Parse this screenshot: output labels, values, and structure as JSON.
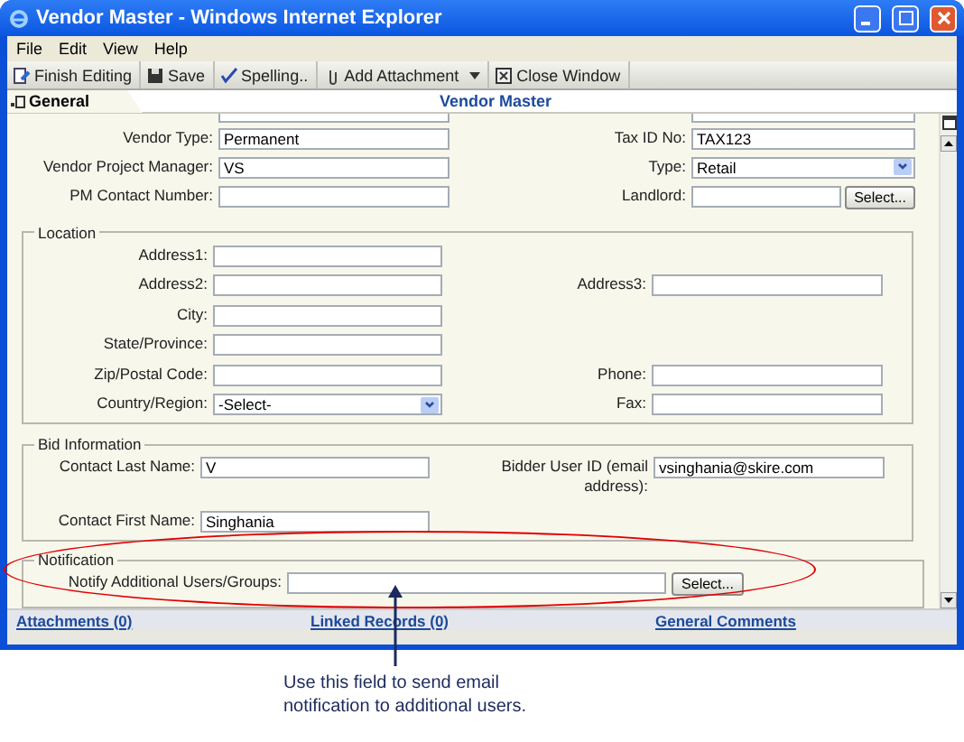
{
  "window": {
    "title": "Vendor Master - Windows Internet Explorer"
  },
  "menu": [
    "File",
    "Edit",
    "View",
    "Help"
  ],
  "toolbar": [
    {
      "label": "Finish Editing",
      "has_menu": false
    },
    {
      "label": "Save",
      "has_menu": false
    },
    {
      "label": "Spelling..",
      "has_menu": false
    },
    {
      "label": "Add Attachment",
      "has_menu": true
    },
    {
      "label": "Close Window",
      "has_menu": false
    }
  ],
  "tab": {
    "label": "General",
    "selected": true
  },
  "form_title": "Vendor Master",
  "header_rows": [
    {
      "left": {
        "label": "Vendor Type:",
        "value": "Permanent",
        "kind": "text"
      },
      "right": {
        "label": "Tax ID No:",
        "value": "TAX123",
        "kind": "text"
      }
    },
    {
      "left": {
        "label": "Vendor Project Manager:",
        "value": "VS",
        "kind": "text"
      },
      "right": {
        "label": "Type:",
        "value": "Retail",
        "kind": "select"
      }
    },
    {
      "left": {
        "label": "PM Contact Number:",
        "kind": "text"
      },
      "right": {
        "label": "Landlord:",
        "kind": "picker",
        "button": "Select..."
      }
    }
  ],
  "location": {
    "legend": "Location",
    "rows": [
      {
        "left": {
          "label": "Address1:",
          "kind": "text"
        }
      },
      {
        "left": {
          "label": "Address2:",
          "kind": "text"
        },
        "right": {
          "label": "Address3:",
          "kind": "text"
        }
      },
      {
        "left": {
          "label": "City:",
          "kind": "text"
        }
      },
      {
        "left": {
          "label": "State/Province:",
          "kind": "text"
        }
      },
      {
        "left": {
          "label": "Zip/Postal Code:",
          "kind": "text"
        },
        "right": {
          "label": "Phone:",
          "kind": "text"
        }
      },
      {
        "left": {
          "label": "Country/Region:",
          "value": "-Select-",
          "kind": "select"
        },
        "right": {
          "label": "Fax:",
          "kind": "text"
        }
      }
    ]
  },
  "bid": {
    "legend": "Bid Information",
    "rows": [
      {
        "left": {
          "label": "Contact Last Name:",
          "value": "V",
          "kind": "text"
        },
        "right": {
          "label": "Bidder User ID (email address):",
          "value": "vsinghania@skire.com",
          "kind": "text"
        }
      },
      {
        "left": {
          "label": "Contact First Name:",
          "value": "Singhania",
          "kind": "text"
        }
      }
    ]
  },
  "notification": {
    "legend": "Notification",
    "label": "Notify Additional Users/Groups:",
    "button": "Select..."
  },
  "links": [
    "Attachments (0)",
    "Linked Records (0)",
    "General Comments"
  ],
  "annotation": "Use this field to send email notification to additional users."
}
